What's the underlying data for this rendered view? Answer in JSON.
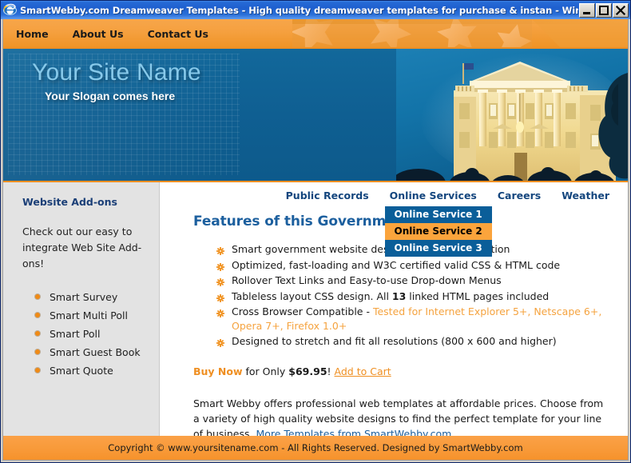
{
  "window": {
    "title": "SmartWebby.com Dreamweaver Templates - High quality dreamweaver templates for purchase & instan - Windows Interne...",
    "icon": "internet-explorer-icon",
    "minimize_label": "Minimize",
    "restore_label": "Restore",
    "close_label": "Close"
  },
  "topnav": {
    "items": [
      {
        "label": "Home"
      },
      {
        "label": "About Us"
      },
      {
        "label": "Contact Us"
      }
    ]
  },
  "hero": {
    "site_name": "Your Site Name",
    "slogan": "Your Slogan comes here",
    "photo_alt": "white-house-photo"
  },
  "sidebar": {
    "heading": "Website Add-ons",
    "intro": "Check out our easy to integrate Web Site Add-ons!",
    "items": [
      {
        "label": "Smart Survey"
      },
      {
        "label": "Smart Multi Poll"
      },
      {
        "label": "Smart Poll"
      },
      {
        "label": "Smart Guest Book"
      },
      {
        "label": "Smart Quote"
      }
    ]
  },
  "subnav": {
    "items": [
      {
        "label": "Public Records"
      },
      {
        "label": "Online Services"
      },
      {
        "label": "Careers"
      },
      {
        "label": "Weather"
      }
    ],
    "dropdown": {
      "parent": "Online Services",
      "items": [
        {
          "label": "Online Service 1",
          "state": "normal"
        },
        {
          "label": "Online Service 2",
          "state": "hovered"
        },
        {
          "label": "Online Service 3",
          "state": "normal"
        }
      ]
    }
  },
  "content": {
    "title": "Features of this Government Template",
    "features": [
      {
        "text": "Smart government website design with neat navigation"
      },
      {
        "text": "Optimized, fast-loading and W3C certified valid CSS & HTML code"
      },
      {
        "text": "Rollover Text Links and Easy-to-use Drop-down Menus"
      },
      {
        "pre": "Tableless layout CSS design. All ",
        "bold": "13",
        "post": " linked HTML pages included"
      },
      {
        "pre": "Cross Browser Compatible - ",
        "highlight": "Tested for Internet Explorer 5+, Netscape 6+, Opera 7+, Firefox 1.0+"
      },
      {
        "text": "Designed to stretch and fit all resolutions (800 x 600 and higher)"
      }
    ],
    "buy": {
      "buy_now": "Buy Now",
      "for_only": " for Only ",
      "price": "$69.95",
      "bang": "!",
      "cart_link": "Add to Cart"
    },
    "blurb": {
      "text": "Smart Webby offers professional web templates at affordable prices. Choose from a variety of high quality website designs to find the perfect template for your line of business. ",
      "link": "More Templates from SmartWebby.com"
    }
  },
  "footer": {
    "text": "Copyright © www.yoursitename.com - All Rights Reserved. Designed by SmartWebby.com"
  },
  "colors": {
    "orange": "#f59a2d",
    "hero_blue": "#0d6292",
    "nav_blue": "#14467e",
    "dropdown_blue": "#0a5e99",
    "dropdown_hover": "#fba43c",
    "title_blue": "#1c5f9e",
    "bullet_orange": "#f08a15",
    "sidebar_bg": "#e3e3e3"
  }
}
